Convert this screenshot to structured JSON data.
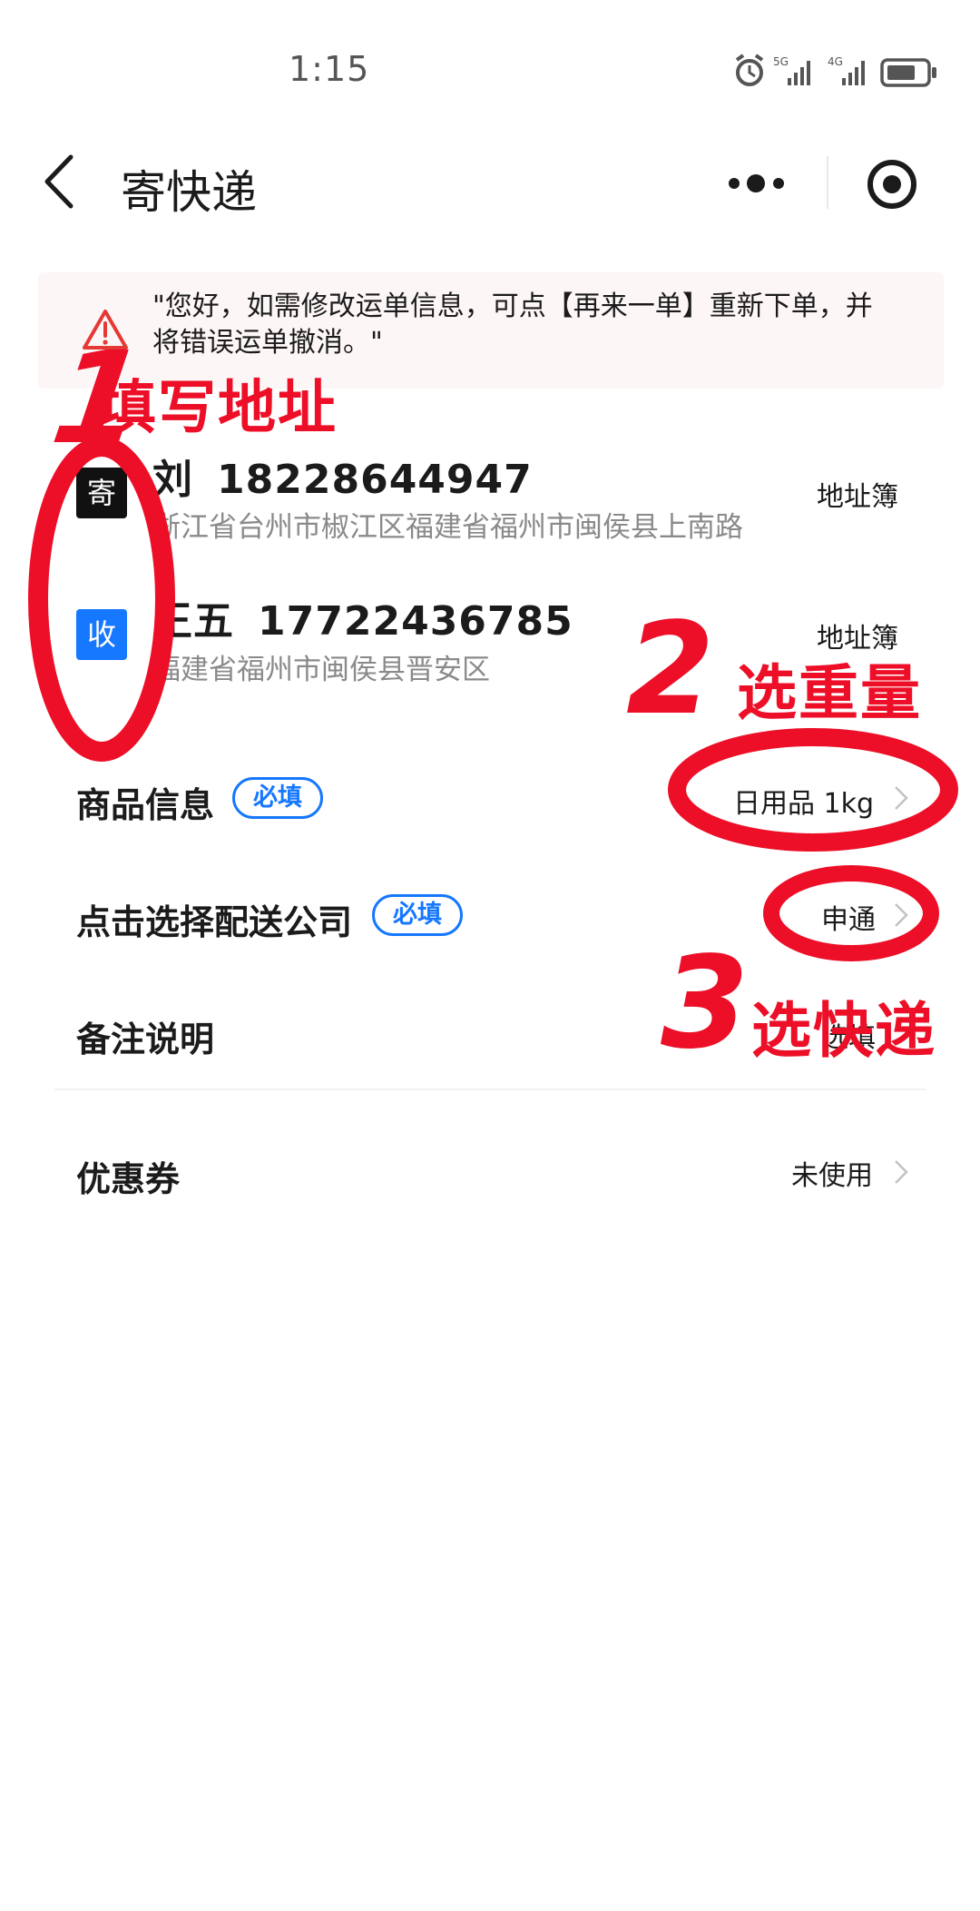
{
  "status_bar": {
    "time": "1:15",
    "icons": [
      "alarm-icon",
      "signal-5g-icon",
      "signal-4g-icon",
      "battery-icon"
    ]
  },
  "header": {
    "back_icon": "back-arrow-icon",
    "title": "寄快递",
    "more_icon": "more-dots-icon",
    "target_icon": "target-icon"
  },
  "notice": {
    "icon": "warning-icon",
    "text": "\"您好，如需修改运单信息，可点【再来一单】重新下单，并将错误运单撤消。\""
  },
  "sender": {
    "tag": "寄",
    "name": "刘",
    "phone": "18228644947",
    "address": "浙江省台州市椒江区福建省福州市闽侯县上南路",
    "book_label": "地址簿"
  },
  "receiver": {
    "tag": "收",
    "name": "王五",
    "phone": "17722436785",
    "address": "福建省福州市闽侯县晋安区",
    "book_label": "地址簿"
  },
  "form": {
    "goods": {
      "label": "商品信息",
      "badge": "必填",
      "value": "日用品 1kg"
    },
    "carrier": {
      "label": "点击选择配送公司",
      "badge": "必填",
      "value": "申通"
    },
    "note": {
      "label": "备注说明",
      "value": "选填"
    },
    "coupon": {
      "label": "优惠券",
      "value": "未使用"
    }
  },
  "annotations": [
    {
      "number": "1",
      "text": "填写地址"
    },
    {
      "number": "2",
      "text": "选重量"
    },
    {
      "number": "3",
      "text": "选快递"
    }
  ],
  "colors": {
    "accent_blue": "#1677ff",
    "annotation_red": "#ec0f27",
    "notice_bg": "#fdf6f6"
  }
}
